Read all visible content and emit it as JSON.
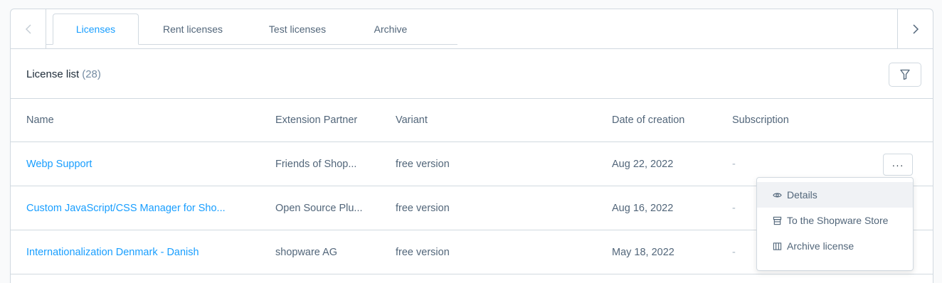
{
  "tabs": [
    {
      "label": "Licenses",
      "active": true
    },
    {
      "label": "Rent licenses",
      "active": false
    },
    {
      "label": "Test licenses",
      "active": false
    },
    {
      "label": "Archive",
      "active": false
    }
  ],
  "list": {
    "title": "License list",
    "count": "(28)"
  },
  "columns": {
    "name": "Name",
    "partner": "Extension Partner",
    "variant": "Variant",
    "date": "Date of creation",
    "subscription": "Subscription"
  },
  "rows": [
    {
      "name": "Webp Support",
      "partner": "Friends of Shop...",
      "variant": "free version",
      "date": "Aug 22, 2022",
      "subscription": "-"
    },
    {
      "name": "Custom JavaScript/CSS Manager for Sho...",
      "partner": "Open Source Plu...",
      "variant": "free version",
      "date": "Aug 16, 2022",
      "subscription": "-"
    },
    {
      "name": "Internationalization Denmark - Danish",
      "partner": "shopware AG",
      "variant": "free version",
      "date": "May 18, 2022",
      "subscription": "-"
    }
  ],
  "more_button": {
    "label": "···"
  },
  "context_menu": {
    "items": [
      {
        "label": "Details",
        "icon": "eye-icon"
      },
      {
        "label": "To the Shopware Store",
        "icon": "store-icon"
      },
      {
        "label": "Archive license",
        "icon": "archive-icon"
      }
    ]
  },
  "icons": {
    "prev": "chevron-left-icon",
    "next": "chevron-right-icon",
    "filter": "filter-icon"
  },
  "colors": {
    "accent": "#189eff",
    "text": "#52667a",
    "heading": "#1d2b38",
    "border": "#d1d9e0"
  }
}
